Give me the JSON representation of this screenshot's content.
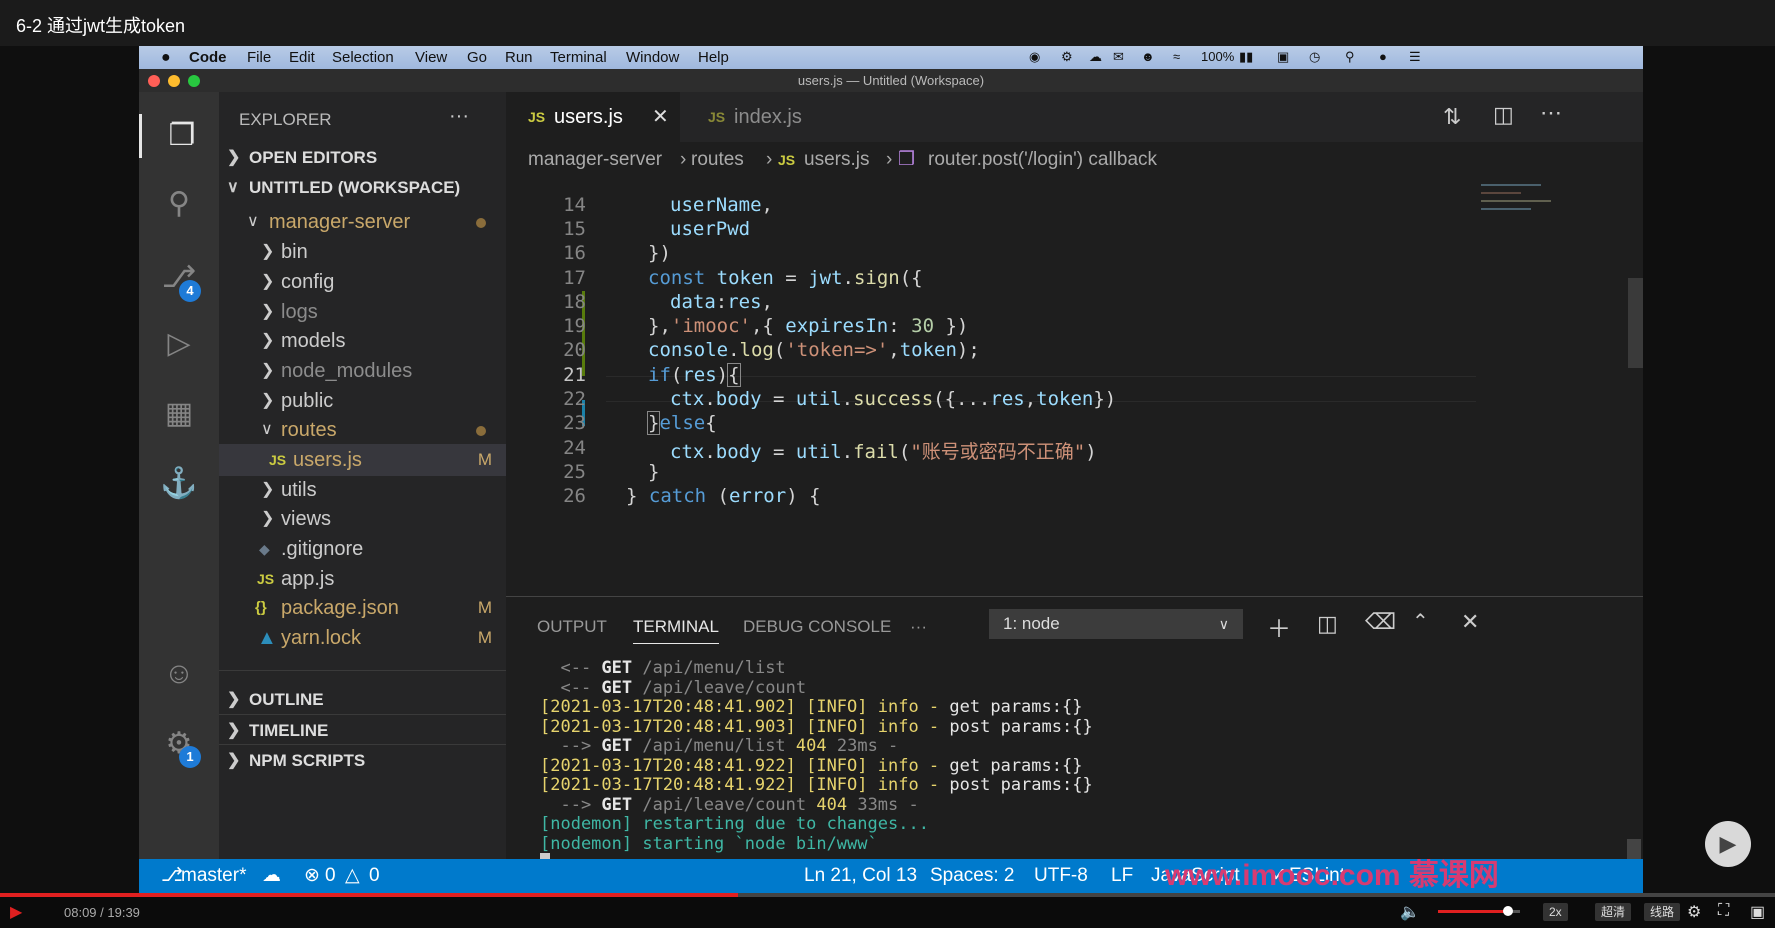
{
  "video": {
    "title": "6-2 通过jwt生成token",
    "time": "08:09 / 19:39",
    "progress": 0.416,
    "volume": 0.85,
    "speed": "2x",
    "quality": "超清",
    "line": "线路"
  },
  "menubar": {
    "apple": "",
    "app": "Code",
    "items": [
      "File",
      "Edit",
      "Selection",
      "View",
      "Go",
      "Run",
      "Terminal",
      "Window",
      "Help"
    ],
    "battery": "100%"
  },
  "window_title": "users.js — Untitled (Workspace)",
  "activity": {
    "scm_badge": "4",
    "settings_badge": "1"
  },
  "explorer": {
    "title": "EXPLORER",
    "more": "···",
    "open_editors": "OPEN EDITORS",
    "workspace": "UNTITLED (WORKSPACE)",
    "root": "manager-server",
    "items": [
      {
        "label": "bin"
      },
      {
        "label": "config"
      },
      {
        "label": "logs"
      },
      {
        "label": "models"
      },
      {
        "label": "node_modules"
      },
      {
        "label": "public"
      },
      {
        "label": "routes"
      },
      {
        "label": "users.js",
        "badge": "M"
      },
      {
        "label": "utils"
      },
      {
        "label": "views"
      },
      {
        "label": ".gitignore"
      },
      {
        "label": "app.js"
      },
      {
        "label": "package.json",
        "badge": "M"
      },
      {
        "label": "yarn.lock",
        "badge": "M"
      }
    ],
    "outline": "OUTLINE",
    "timeline": "TIMELINE",
    "npm": "NPM SCRIPTS",
    "js_label": "JS",
    "json_label": "{}"
  },
  "tabs": [
    {
      "label": "users.js",
      "active": true
    },
    {
      "label": "index.js",
      "active": false
    }
  ],
  "breadcrumb": [
    "manager-server",
    "routes",
    "users.js",
    "router.post('/login') callback"
  ],
  "code": {
    "line_numbers": [
      "14",
      "15",
      "16",
      "17",
      "18",
      "19",
      "20",
      "21",
      "22",
      "23",
      "24",
      "25",
      "26"
    ]
  },
  "panel": {
    "tabs": [
      "OUTPUT",
      "TERMINAL",
      "DEBUG CONSOLE",
      "···"
    ],
    "active": "TERMINAL",
    "terminal_select": "1: node"
  },
  "status": {
    "branch": "master*",
    "errors": "0",
    "warnings": "0",
    "position": "Ln 21, Col 13",
    "spaces": "Spaces: 2",
    "encoding": "UTF-8",
    "eol": "LF",
    "language": "JavaScript",
    "eslint": "ESLint"
  },
  "watermark": "www.imooc.com 慕课网"
}
